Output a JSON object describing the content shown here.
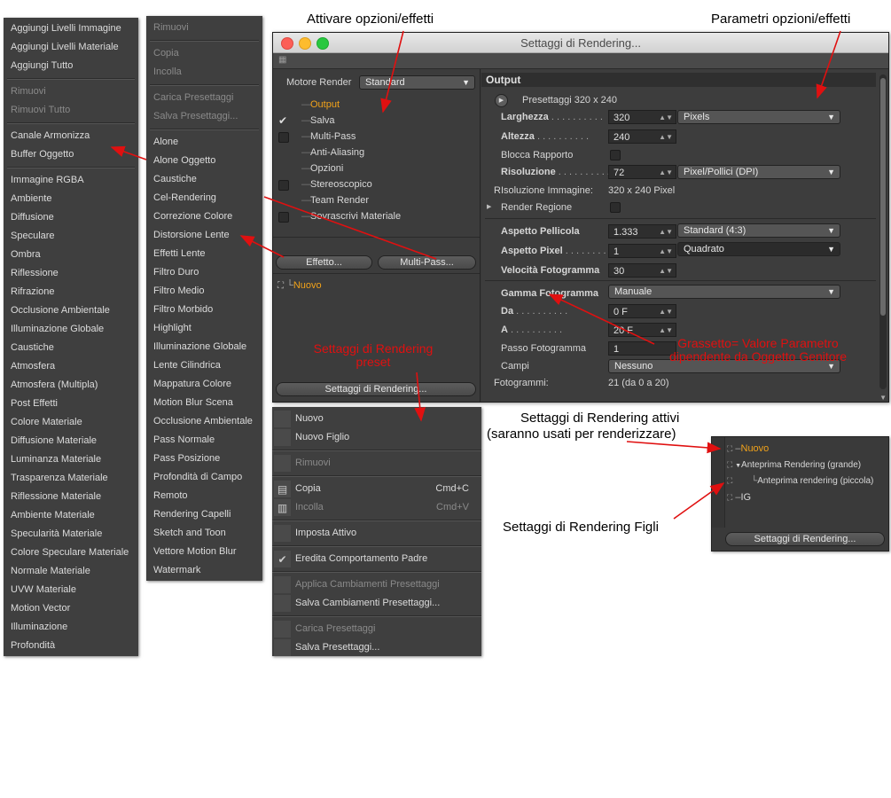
{
  "menu_left": {
    "items": [
      {
        "label": "Aggiungi Livelli Immagine",
        "disabled": false
      },
      {
        "label": "Aggiungi Livelli Materiale",
        "disabled": false
      },
      {
        "label": "Aggiungi Tutto",
        "disabled": false
      },
      {
        "sep": true
      },
      {
        "label": "Rimuovi",
        "disabled": true
      },
      {
        "label": "Rimuovi Tutto",
        "disabled": true
      },
      {
        "sep": true
      },
      {
        "label": "Canale Armonizza",
        "disabled": false
      },
      {
        "label": "Buffer Oggetto",
        "disabled": false
      },
      {
        "sep": true
      },
      {
        "label": "Immagine RGBA",
        "disabled": false
      },
      {
        "label": "Ambiente",
        "disabled": false
      },
      {
        "label": "Diffusione",
        "disabled": false
      },
      {
        "label": "Speculare",
        "disabled": false
      },
      {
        "label": "Ombra",
        "disabled": false
      },
      {
        "label": "Riflessione",
        "disabled": false
      },
      {
        "label": "Rifrazione",
        "disabled": false
      },
      {
        "label": "Occlusione Ambientale",
        "disabled": false
      },
      {
        "label": "Illuminazione Globale",
        "disabled": false
      },
      {
        "label": "Caustiche",
        "disabled": false
      },
      {
        "label": "Atmosfera",
        "disabled": false
      },
      {
        "label": "Atmosfera (Multipla)",
        "disabled": false
      },
      {
        "label": "Post Effetti",
        "disabled": false
      },
      {
        "label": "Colore Materiale",
        "disabled": false
      },
      {
        "label": "Diffusione Materiale",
        "disabled": false
      },
      {
        "label": "Luminanza Materiale",
        "disabled": false
      },
      {
        "label": "Trasparenza Materiale",
        "disabled": false
      },
      {
        "label": "Riflessione Materiale",
        "disabled": false
      },
      {
        "label": "Ambiente Materiale",
        "disabled": false
      },
      {
        "label": "Specularità Materiale",
        "disabled": false
      },
      {
        "label": "Colore Speculare Materiale",
        "disabled": false
      },
      {
        "label": "Normale Materiale",
        "disabled": false
      },
      {
        "label": "UVW Materiale",
        "disabled": false
      },
      {
        "label": "Motion Vector",
        "disabled": false
      },
      {
        "label": "Illuminazione",
        "disabled": false
      },
      {
        "label": "Profondità",
        "disabled": false
      }
    ]
  },
  "menu_effects": {
    "items": [
      {
        "label": "Rimuovi",
        "disabled": true
      },
      {
        "sep": true
      },
      {
        "label": "Copia",
        "disabled": true
      },
      {
        "label": "Incolla",
        "disabled": true
      },
      {
        "sep": true
      },
      {
        "label": "Carica Presettaggi",
        "disabled": true
      },
      {
        "label": "Salva Presettaggi...",
        "disabled": true
      },
      {
        "sep": true
      },
      {
        "label": "Alone",
        "disabled": false
      },
      {
        "label": "Alone Oggetto",
        "disabled": false
      },
      {
        "label": "Caustiche",
        "disabled": false
      },
      {
        "label": "Cel-Rendering",
        "disabled": false
      },
      {
        "label": "Correzione Colore",
        "disabled": false
      },
      {
        "label": "Distorsione Lente",
        "disabled": false
      },
      {
        "label": "Effetti Lente",
        "disabled": false
      },
      {
        "label": "Filtro Duro",
        "disabled": false
      },
      {
        "label": "Filtro Medio",
        "disabled": false
      },
      {
        "label": "Filtro Morbido",
        "disabled": false
      },
      {
        "label": "Highlight",
        "disabled": false
      },
      {
        "label": "Illuminazione Globale",
        "disabled": false
      },
      {
        "label": "Lente Cilindrica",
        "disabled": false
      },
      {
        "label": "Mappatura Colore",
        "disabled": false
      },
      {
        "label": "Motion Blur Scena",
        "disabled": false
      },
      {
        "label": "Occlusione Ambientale",
        "disabled": false
      },
      {
        "label": "Pass Normale",
        "disabled": false
      },
      {
        "label": "Pass Posizione",
        "disabled": false
      },
      {
        "label": "Profondità di Campo",
        "disabled": false
      },
      {
        "label": "Remoto",
        "disabled": false
      },
      {
        "label": "Rendering Capelli",
        "disabled": false
      },
      {
        "label": "Sketch and Toon",
        "disabled": false
      },
      {
        "label": "Vettore Motion Blur",
        "disabled": false
      },
      {
        "label": "Watermark",
        "disabled": false
      }
    ]
  },
  "window": {
    "title": "Settaggi di Rendering...",
    "renderer_label": "Motore Render",
    "renderer_value": "Standard",
    "options": [
      {
        "label": "Output",
        "checked": false,
        "has_box": false,
        "active": true
      },
      {
        "label": "Salva",
        "checked": true,
        "has_box": true,
        "active": false
      },
      {
        "label": "Multi-Pass",
        "checked": false,
        "has_box": true,
        "active": false
      },
      {
        "label": "Anti-Aliasing",
        "checked": false,
        "has_box": false,
        "active": false
      },
      {
        "label": "Opzioni",
        "checked": false,
        "has_box": false,
        "active": false
      },
      {
        "label": "Stereoscopico",
        "checked": false,
        "has_box": true,
        "active": false
      },
      {
        "label": "Team Render",
        "checked": false,
        "has_box": false,
        "active": false
      },
      {
        "label": "Sovrascrivi Materiale",
        "checked": false,
        "has_box": true,
        "active": false
      }
    ],
    "effect_button": "Effetto...",
    "multipass_button": "Multi-Pass...",
    "preset_item": "Nuovo",
    "bottom_button": "Settaggi di Rendering...",
    "output": {
      "header": "Output",
      "preset": "Presettaggi 320 x 240",
      "larghezza_label": "Larghezza",
      "larghezza": "320",
      "unit": "Pixels",
      "altezza_label": "Altezza",
      "altezza": "240",
      "blocca_label": "Blocca Rapporto",
      "risoluzione_label": "Risoluzione",
      "risoluzione": "72",
      "res_unit": "Pixel/Pollici (DPI)",
      "ris_img_label": "RIsoluzione Immagine:",
      "ris_img": "320 x 240 Pixel",
      "regione_label": "Render Regione",
      "aspetto_pell_label": "Aspetto Pellicola",
      "aspetto_pell": "1.333",
      "aspetto_pell_dd": "Standard (4:3)",
      "aspetto_pix_label": "Aspetto Pixel",
      "aspetto_pix": "1",
      "aspetto_pix_dd": "Quadrato",
      "velocita_label": "Velocità Fotogramma",
      "velocita": "30",
      "gamma_label": "Gamma Fotogramma",
      "gamma_dd": "Manuale",
      "da_label": "Da",
      "da": "0 F",
      "a_label": "A",
      "a": "20 F",
      "passo_label": "Passo Fotogramma",
      "passo": "1",
      "campi_label": "Campi",
      "campi": "Nessuno",
      "fotogrammi_label": "Fotogrammi:",
      "fotogrammi": "21 (da 0 a 20)"
    }
  },
  "context_menu": {
    "items": [
      {
        "label": "Nuovo",
        "shortcut": "",
        "disabled": false,
        "icon": ""
      },
      {
        "label": "Nuovo Figlio",
        "shortcut": "",
        "disabled": false,
        "icon": ""
      },
      {
        "sep": true
      },
      {
        "label": "Rimuovi",
        "shortcut": "",
        "disabled": true,
        "icon": ""
      },
      {
        "sep": true
      },
      {
        "label": "Copia",
        "shortcut": "Cmd+C",
        "disabled": false,
        "icon": "copy-icon"
      },
      {
        "label": "Incolla",
        "shortcut": "Cmd+V",
        "disabled": true,
        "icon": "paste-icon"
      },
      {
        "sep": true
      },
      {
        "label": "Imposta Attivo",
        "shortcut": "",
        "disabled": false,
        "icon": ""
      },
      {
        "sep": true
      },
      {
        "label": "Eredita Comportamento Padre",
        "shortcut": "",
        "disabled": false,
        "icon": "check-icon"
      },
      {
        "sep": true
      },
      {
        "label": "Applica Cambiamenti Presettaggi",
        "shortcut": "",
        "disabled": true,
        "icon": ""
      },
      {
        "label": "Salva Cambiamenti Presettaggi...",
        "shortcut": "",
        "disabled": false,
        "icon": ""
      },
      {
        "sep": true
      },
      {
        "label": "Carica Presettaggi",
        "shortcut": "",
        "disabled": true,
        "icon": ""
      },
      {
        "label": "Salva Presettaggi...",
        "shortcut": "",
        "disabled": false,
        "icon": ""
      }
    ]
  },
  "children_panel": {
    "items": [
      {
        "label": "Nuovo"
      },
      {
        "label": "Anteprima Rendering (grande)"
      },
      {
        "label": "Anteprima rendering (piccola)"
      },
      {
        "label": "IG"
      }
    ],
    "button": "Settaggi di Rendering..."
  },
  "annotations": {
    "attivare": "Attivare opzioni/effetti",
    "parametri": "Parametri opzioni/effetti",
    "preset_red": "Settaggi di Rendering preset",
    "grassetto_red": "Grassetto= Valore Parametro dipendente da Oggetto Genitore",
    "attivi": "Settaggi di Rendering attivi",
    "attivi2": "(saranno usati per renderizzare)",
    "figli": "Settaggi di Rendering Figli"
  },
  "colors": {
    "accent_orange": "#f1a21a",
    "annotation_red": "#e01010"
  }
}
